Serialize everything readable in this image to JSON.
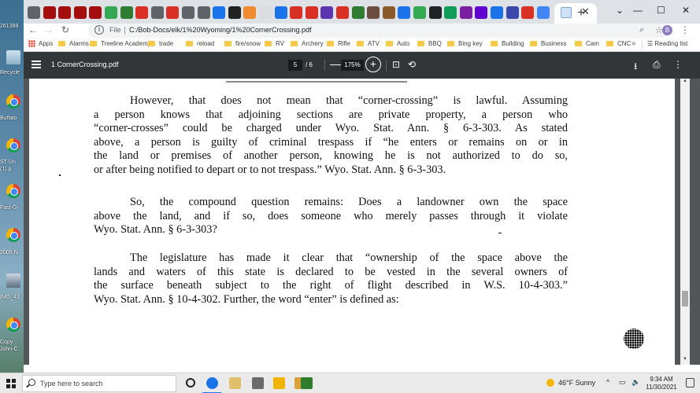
{
  "desktop": {
    "items": [
      {
        "label": "261389",
        "icon": "file-icon"
      },
      {
        "label": "Recycle",
        "icon": "recycle-bin-icon"
      },
      {
        "label": "Buffalo",
        "icon": "chrome-icon"
      },
      {
        "label": "ST-Un",
        "icon": "chrome-icon"
      },
      {
        "label": "(1).p",
        "icon": ""
      },
      {
        "label": "Fast-Gr",
        "icon": "chrome-icon"
      },
      {
        "label": "2008-N",
        "icon": "chrome-icon"
      },
      {
        "label": "IMG_43",
        "icon": "image-icon"
      },
      {
        "label": "Copy",
        "icon": "chrome-icon"
      },
      {
        "label": "John-C",
        "icon": ""
      }
    ]
  },
  "browser": {
    "active_tab_close": "✕",
    "new_tab": "+",
    "window_controls": {
      "minimize": "—",
      "maximize": "☐",
      "close": "✕"
    },
    "tab_colors": [
      "#5f6368",
      "#a50e0e",
      "#a50e0e",
      "#a50e0e",
      "#a50e0e",
      "#34a853",
      "#2e7d32",
      "#d93025",
      "#5f6368",
      "#d93025",
      "#5f6368",
      "#5f6368",
      "#1a73e8",
      "#222222",
      "#f28b30",
      "#dadce0",
      "#1a73e8",
      "#d93025",
      "#d93025",
      "#5e35b1",
      "#d93025",
      "#2e7d32",
      "#6d4c41",
      "#8b5a2b",
      "#1a73e8",
      "#34a853",
      "#202124",
      "#0f9d58",
      "#7b1fa2",
      "#6001d2",
      "#1a73e8",
      "#3949ab",
      "#d93025",
      "#4285f4"
    ],
    "nav": {
      "back": "←",
      "forward": "→",
      "reload": "↻"
    },
    "omnibox": {
      "info": "i",
      "scheme": "File",
      "url": "C:/Bob-Docs/elk/1%20Wyoming/1%20CornerCrossing.pdf",
      "zoom_icon": "⌕",
      "star_icon": "☆"
    },
    "profile_initial": "B",
    "menu": "⋮"
  },
  "bookmarks": {
    "apps_label": "Apps",
    "items": [
      "Alarms",
      "Treeline Academy",
      "trade",
      "reload",
      "fire/snow",
      "RV",
      "Archery",
      "Rifle",
      "ATV",
      "Auto",
      "BBQ",
      "Bing key",
      "Building",
      "Business",
      "Cam",
      "CNC"
    ],
    "more": "»",
    "reading_list": "Reading list"
  },
  "pdf": {
    "title": "1 CornerCrossing.pdf",
    "page_current": "5",
    "page_total": "/  6",
    "zoom": "175%",
    "zoom_minus": "—",
    "zoom_plus": "+",
    "fit_icon": "⊡",
    "rotate_icon": "⟲",
    "download_icon": "⭳",
    "print_icon": "⎙",
    "more_icon": "⋮",
    "paragraphs": [
      {
        "lines": [
          "However, that does not mean that “corner-crossing” is lawful.  Assuming",
          "a person knows that adjoining sections are private property, a person who",
          "“corner-crosses” could be charged under Wyo. Stat. Ann. § 6-3-303.  As stated",
          "above, a person is guilty of criminal trespass if “he enters or remains on or in",
          "the land or premises of another person, knowing he is not authorized to do so,",
          "or after being notified to depart or to not trespass.”  Wyo. Stat. Ann. § 6-3-303."
        ]
      },
      {
        "lines": [
          "So, the compound question remains:  Does a landowner own the space",
          "above the land, and if so, does someone who merely passes through it violate",
          "Wyo. Stat. Ann. § 6-3-303?"
        ]
      },
      {
        "lines": [
          "The legislature has made it clear that “ownership of the space above the",
          "lands and waters of this state is declared to be vested in the several owners of",
          "the surface beneath subject to the right of flight described in W.S. 10-4-303.”",
          "Wyo. Stat. Ann. § 10-4-302.  Further, the word “enter” is defined as:"
        ]
      }
    ]
  },
  "taskbar": {
    "search_placeholder": "Type here to search",
    "weather": "46°F  Sunny",
    "tray_chevron": "^",
    "volume": "🔈",
    "time": "9:34 AM",
    "date": "11/30/2021",
    "app_colors": [
      "#1a73e8",
      "#e0c06a",
      "#6b6b6b",
      "#f0b400",
      "#d9a13a",
      "#2d7d2d"
    ]
  }
}
